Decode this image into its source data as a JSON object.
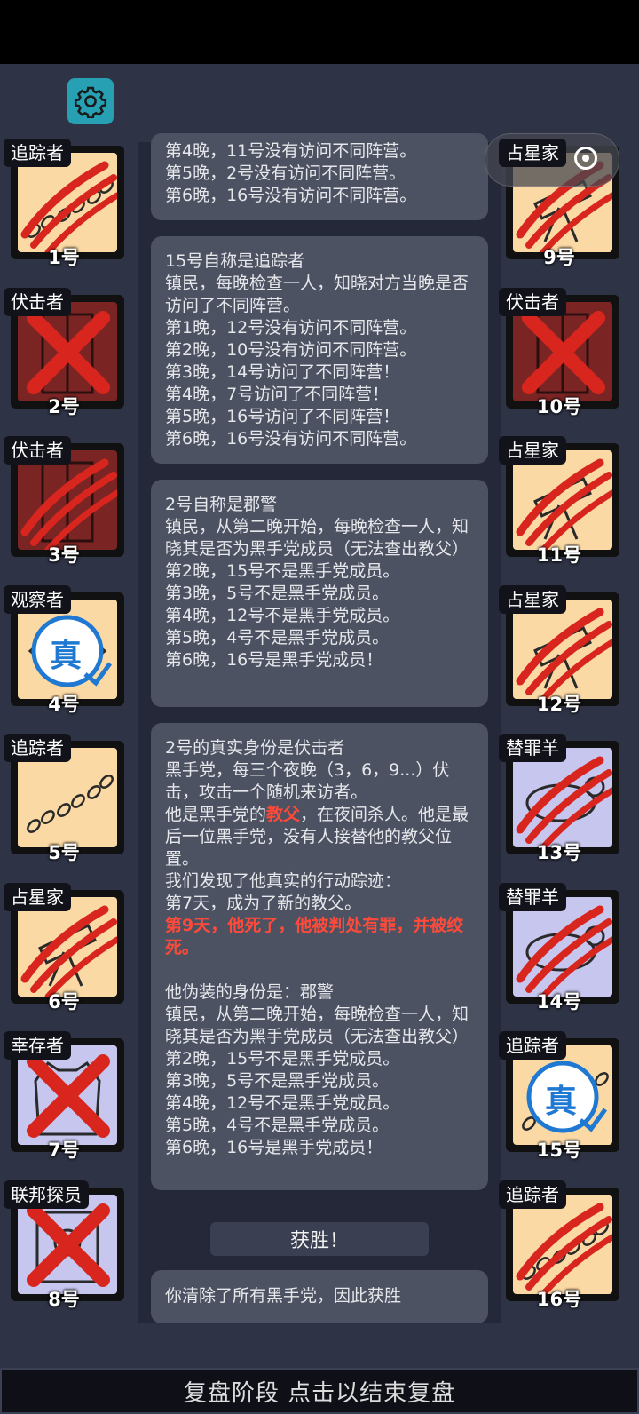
{
  "toolbar": {
    "settings_icon": "gear-icon",
    "capsule_dots": "•••",
    "capsule_icon": "target-icon"
  },
  "colors": {
    "town_bg": "#fbd9a4",
    "evil_bg": "#7a2424",
    "neutral_bg": "#c7c6ee",
    "scratch": "#d8261e",
    "true_badge": "#1f78d1"
  },
  "left_players": [
    {
      "role": "追踪者",
      "number": "1号",
      "icon": "footprints-icon",
      "status": "scratched"
    },
    {
      "role": "伏击者",
      "number": "2号",
      "icon": "door-icon",
      "status": "crossed"
    },
    {
      "role": "伏击者",
      "number": "3号",
      "icon": "door-icon",
      "status": "scratched"
    },
    {
      "role": "观察者",
      "number": "4号",
      "icon": "eye-icon",
      "status": "true"
    },
    {
      "role": "追踪者",
      "number": "5号",
      "icon": "footprints-icon",
      "status": "alive"
    },
    {
      "role": "占星家",
      "number": "6号",
      "icon": "telescope-icon",
      "status": "scratched"
    },
    {
      "role": "幸存者",
      "number": "7号",
      "icon": "vest-icon",
      "status": "crossed"
    },
    {
      "role": "联邦探员",
      "number": "8号",
      "icon": "badge-icon",
      "status": "crossed"
    }
  ],
  "right_players": [
    {
      "role": "占星家",
      "number": "9号",
      "icon": "telescope-icon",
      "status": "scratched"
    },
    {
      "role": "伏击者",
      "number": "10号",
      "icon": "door-icon",
      "status": "crossed"
    },
    {
      "role": "占星家",
      "number": "11号",
      "icon": "telescope-icon",
      "status": "scratched"
    },
    {
      "role": "占星家",
      "number": "12号",
      "icon": "telescope-icon",
      "status": "scratched"
    },
    {
      "role": "替罪羊",
      "number": "13号",
      "icon": "goat-icon",
      "status": "scratched"
    },
    {
      "role": "替罪羊",
      "number": "14号",
      "icon": "goat-icon",
      "status": "scratched"
    },
    {
      "role": "追踪者",
      "number": "15号",
      "icon": "footprints-icon",
      "status": "true"
    },
    {
      "role": "追踪者",
      "number": "16号",
      "icon": "footprints-icon",
      "status": "scratched"
    }
  ],
  "true_badge_text": "真",
  "logs": {
    "log1": [
      "第4晚，11号没有访问不同阵营。",
      "第5晚，2号没有访问不同阵营。",
      "第6晚，16号没有访问不同阵营。"
    ],
    "log2": [
      "15号自称是追踪者",
      "镇民，每晚检查一人，知晓对方当晚是否访问了不同阵营。",
      "第1晚，12号没有访问不同阵营。",
      "第2晚，10号没有访问不同阵营。",
      "第3晚，14号访问了不同阵营！",
      "第4晚，7号访问了不同阵营！",
      "第5晚，16号访问了不同阵营！",
      "第6晚，16号没有访问不同阵营。"
    ],
    "log3": [
      "2号自称是郡警",
      "镇民，从第二晚开始，每晚检查一人，知晓其是否为黑手党成员（无法查出教父）",
      "第2晚，15号不是黑手党成员。",
      "第3晚，5号不是黑手党成员。",
      "第4晚，12号不是黑手党成员。",
      "第5晚，4号不是黑手党成员。",
      "第6晚，16号是黑手党成员！"
    ],
    "log4": {
      "title": "2号的真实身份是伏击者",
      "desc": "黑手党，每三个夜晚（3，6，9...）伏击，攻击一个随机来访者。",
      "godfather_pre": "他是黑手党的",
      "godfather_word": "教父",
      "godfather_post": "，在夜间杀人。他是最后一位黑手党，没有人接替他的教父位置。",
      "found": "我们发现了他真实的行动踪迹：",
      "day7": "第7天，成为了新的教父。",
      "day9": "第9天，他死了，他被判处有罪，并被绞死。",
      "fake_title": "他伪装的身份是：郡警",
      "fake_desc": "镇民，从第二晚开始，每晚检查一人，知晓其是否为黑手党成员（无法查出教父）",
      "fake_lines": [
        "第2晚，15号不是黑手党成员。",
        "第3晚，5号不是黑手党成员。",
        "第4晚，12号不是黑手党成员。",
        "第5晚，4号不是黑手党成员。",
        "第6晚，16号是黑手党成员！"
      ]
    },
    "victory_label": "获胜！",
    "victory_text": "你清除了所有黑手党，因此获胜"
  },
  "bottom_bar": "复盘阶段 点击以结束复盘"
}
